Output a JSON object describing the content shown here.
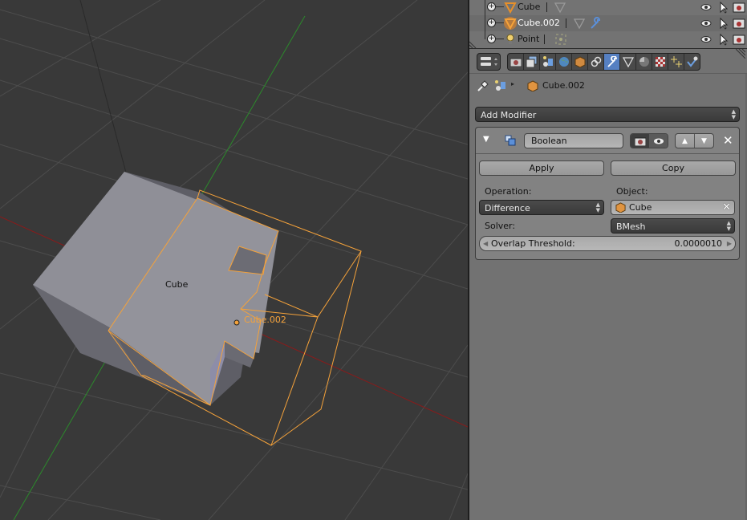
{
  "outliner": {
    "rows": [
      {
        "name": "Cube",
        "type": "mesh",
        "sub_icons": [
          "mesh-data"
        ],
        "active": false
      },
      {
        "name": "Cube.002",
        "type": "mesh",
        "sub_icons": [
          "mesh-data",
          "modifier-wrench"
        ],
        "active": true
      },
      {
        "name": "Point",
        "type": "lamp",
        "sub_icons": [
          "lamp-data"
        ],
        "active": false
      }
    ],
    "restrict_columns": [
      "visibility-eye",
      "selectability-cursor",
      "renderability-camera"
    ]
  },
  "properties": {
    "tabs": [
      "render",
      "render-layers",
      "scene",
      "world",
      "object",
      "constraints",
      "modifiers",
      "data",
      "material",
      "texture",
      "particles",
      "physics"
    ],
    "active_tab": "modifiers",
    "context_path": "Cube.002",
    "add_modifier_label": "Add Modifier",
    "modifier": {
      "name": "Boolean",
      "apply_label": "Apply",
      "copy_label": "Copy",
      "operation_label": "Operation:",
      "operation_value": "Difference",
      "object_label": "Object:",
      "object_value": "Cube",
      "solver_label": "Solver:",
      "solver_value": "BMesh",
      "threshold_label": "Overlap Threshold:",
      "threshold_value": "0.0000010"
    }
  },
  "viewport": {
    "labels": {
      "cube": "Cube",
      "cube002": "Cube.002"
    },
    "colors": {
      "selected": "#f5a23a",
      "background": "#393939",
      "x_axis": "#8b1a1a",
      "y_axis": "#2c8a2c"
    }
  }
}
